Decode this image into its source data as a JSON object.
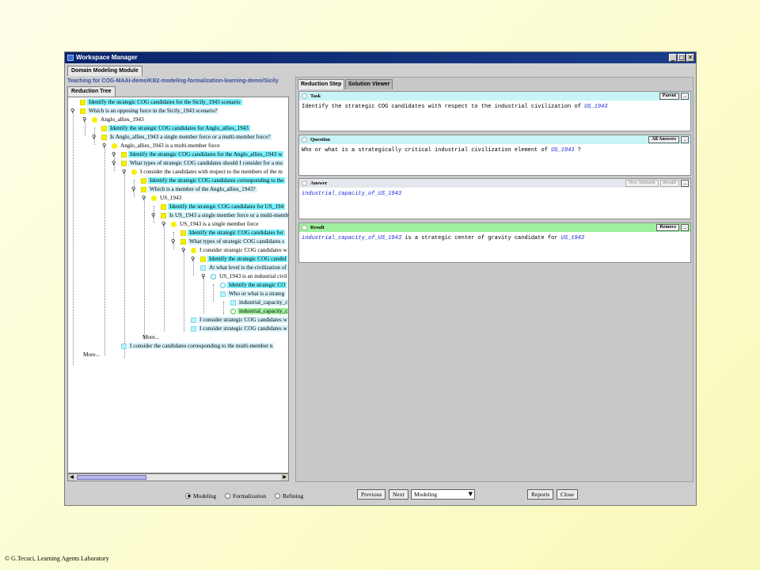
{
  "window": {
    "title": "Workspace Manager",
    "controls": [
      "_",
      "□",
      "✕"
    ]
  },
  "module_tab": "Domain Modeling Module",
  "path": "Teaching for COG-MAAI-demo/KB2-modeling-formalization-learning-demo/Sicily",
  "left": {
    "tab": "Reduction Tree",
    "rows": [
      {
        "text": "Identify the strategic COG candidates for the Sicily_1943 scenario"
      },
      {
        "text": "Which is an opposing force in the Sicily_1943 scenario?"
      },
      {
        "text": "Anglo_allies_1943"
      },
      {
        "text": "Identify the strategic COG candidates for Anglo_allies_1943"
      },
      {
        "text": "Is Anglo_allies_1943 a single member force or a multi-member force?"
      },
      {
        "text": "Anglo_allies_1943 is a multi-member force"
      },
      {
        "text": "Identify the strategic COG candidates for the Anglo_allies_1943 w"
      },
      {
        "text": "What types of strategic COG candidates should I consider for a mu"
      },
      {
        "text": "I consider the candidates with respect to the members of the m"
      },
      {
        "text": "Identify the strategic COG candidates corresponding to the"
      },
      {
        "text": "Which is a member of the Anglo_allies_1943?"
      },
      {
        "text": "US_1943"
      },
      {
        "text": "Identify the strategic COG candidates for US_194"
      },
      {
        "text": "Is US_1943 a single member force or a multi-memb"
      },
      {
        "text": "US_1943 is a single member force"
      },
      {
        "text": "Identify the strategic COG candidates for"
      },
      {
        "text": "What types of strategic COG candidates s"
      },
      {
        "text": "I consider strategic COG candidates w"
      },
      {
        "text": "Identify the strategic COG candid"
      },
      {
        "text": "At what level is the civilization of"
      },
      {
        "text": "US_1943 is an industrial civil"
      },
      {
        "text": "Identify the strategic CO"
      },
      {
        "text": "Who or what is a strateg"
      },
      {
        "text": "industrial_capacity_c"
      },
      {
        "text": "industrial_capacity_c"
      },
      {
        "text": "I consider strategic COG candidates w"
      },
      {
        "text": "I consider strategic COG candidates w"
      },
      {
        "text": "More..."
      },
      {
        "text": "I consider the candidates corresponding to the multi-member n"
      },
      {
        "text": "More..."
      }
    ],
    "scroll_left_icon": "left-arrow-icon",
    "scroll_right_icon": "right-arrow-icon"
  },
  "right": {
    "tabs": [
      "Reduction Step",
      "Solution Viewer"
    ],
    "task": {
      "label": "Task",
      "button": "Parent",
      "pre": "Identify the strategic COG candidates with respect to the industrial civilization of ",
      "obj": "US_1943"
    },
    "question": {
      "label": "Question",
      "button": "All Answers",
      "pre": "Who or what is a strategically critical industrial civilization element of ",
      "obj": "US_1943",
      "post": " ?"
    },
    "answer": {
      "label": "Answer",
      "button1": "New Subtask",
      "button2": "Result",
      "obj": "industrial_capacity_of_US_1943"
    },
    "result": {
      "label": "Result",
      "button": "Remove",
      "obj1": "industrial_capacity_of_US_1943",
      "mid": " is a strategic center of gravity candidate for ",
      "obj2": "US_1943"
    },
    "minimize_label": "_"
  },
  "bottom": {
    "modes": [
      {
        "label": "Modeling",
        "selected": true
      },
      {
        "label": "Formalization",
        "selected": false
      },
      {
        "label": "Refining",
        "selected": false
      }
    ],
    "previous": "Previous",
    "next": "Next",
    "mode_select": "Modeling",
    "reports": "Reports",
    "close": "Close"
  },
  "footer": "© G.Tecuci, Learning Agents Laboratory"
}
